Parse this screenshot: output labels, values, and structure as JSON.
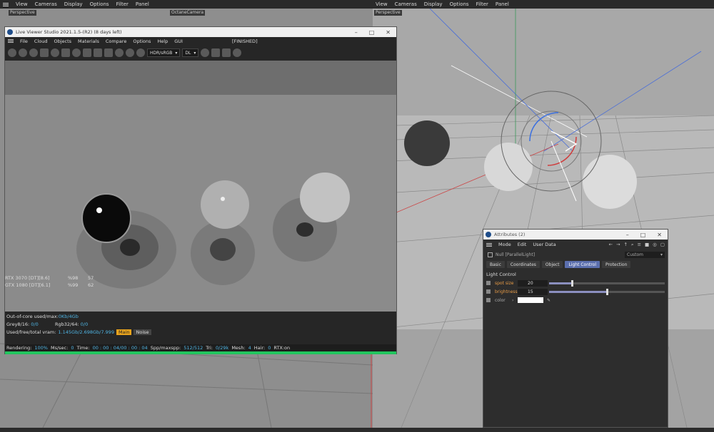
{
  "left_menubar": {
    "items": [
      "View",
      "Cameras",
      "Display",
      "Options",
      "Filter",
      "Panel"
    ]
  },
  "right_menubar": {
    "items": [
      "View",
      "Cameras",
      "Display",
      "Options",
      "Filter",
      "Panel"
    ]
  },
  "left_viewport": {
    "label": "Perspective",
    "camera_label": "OctaneCamera"
  },
  "right_viewport": {
    "label": "Perspective"
  },
  "live_viewer": {
    "title": "Live Viewer Studio 2021.1.5-(R2) (8 days left)",
    "menu": [
      "File",
      "Cloud",
      "Objects",
      "Materials",
      "Compare",
      "Options",
      "Help",
      "GUI"
    ],
    "status_tag": "[FINISHED]",
    "color_space": "HDR/sRGB",
    "mode": "DL",
    "gpu": [
      {
        "name": "RTX 3070 [DT][8.6]",
        "util": "%98",
        "temp": "57"
      },
      {
        "name": "GTX 1080 [DT][6.1]",
        "util": "%99",
        "temp": "62"
      }
    ],
    "out_of_core_label": "Out-of-core used/max:",
    "out_of_core_value": "0Kb/4Gb",
    "grey_label": "Grey8/16:",
    "grey_value": "0/0",
    "rgb_label": "Rgb32/64:",
    "rgb_value": "0/0",
    "vram_label": "Used/free/total vram:",
    "vram_value": "1.145Gb/2.698Gb/7.999",
    "main_button": "Main",
    "noise_button": "Noise",
    "rendering_label": "Rendering:",
    "rendering_value": "100%",
    "ms_label": "Ms/sec:",
    "ms_value": "0",
    "time_label": "Time:",
    "time_value": "00 : 00 : 04/00 : 00 : 04",
    "spp_label": "Spp/maxspp:",
    "spp_value": "512/512",
    "tri_label": "Tri:",
    "tri_value": "0/29k",
    "mesh_label": "Mesh:",
    "mesh_value": "4",
    "hair_label": "Hair:",
    "hair_value": "0",
    "rtx_label": "RTX:on",
    "progress": 1.0
  },
  "attributes": {
    "title": "Attributes (2)",
    "menu": [
      "Mode",
      "Edit",
      "User Data"
    ],
    "object_name": "Null [ParallelLight]",
    "preset": "Custom",
    "tabs": [
      "Basic",
      "Coordinates",
      "Object",
      "Light Control",
      "Protection"
    ],
    "active_tab": "Light Control",
    "section": "Light Control",
    "params": [
      {
        "label": "spot size",
        "value": "20",
        "level": 0.2
      },
      {
        "label": "brightness",
        "value": "15",
        "level": 0.5
      }
    ],
    "color_label": "color"
  },
  "colors": {
    "accent": "#5b6fae",
    "param_label": "#e69a45",
    "progress": "#22c55e"
  }
}
